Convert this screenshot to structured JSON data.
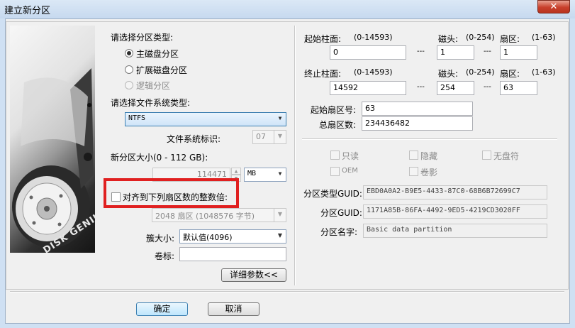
{
  "window": {
    "title": "建立新分区",
    "close_glyph": "✕"
  },
  "image_text": "DISK GENIUS",
  "partition_type": {
    "label": "请选择分区类型:",
    "options": [
      {
        "label": "主磁盘分区",
        "selected": true,
        "enabled": true
      },
      {
        "label": "扩展磁盘分区",
        "selected": false,
        "enabled": true
      },
      {
        "label": "逻辑分区",
        "selected": false,
        "enabled": false
      }
    ]
  },
  "filesystem": {
    "label": "请选择文件系统类型:",
    "value": "NTFS"
  },
  "fs_id": {
    "label": "文件系统标识:",
    "value": "07"
  },
  "size": {
    "label": "新分区大小(0 - 112 GB):",
    "value": "114471",
    "unit": "MB"
  },
  "align": {
    "label": "对齐到下列扇区数的整数倍:",
    "checked": false,
    "value": "2048 扇区 (1048576 字节)"
  },
  "cluster": {
    "label": "簇大小:",
    "value": "默认值(4096)"
  },
  "volume_label": {
    "label": "卷标:",
    "value": ""
  },
  "advanced_button": "详细参数<<",
  "start": {
    "cylinder_label": "起始柱面:",
    "cylinder_range": "(0-14593)",
    "cylinder": "0",
    "head_label": "磁头:",
    "head_range": "(0-254)",
    "head": "1",
    "sector_label": "扇区:",
    "sector_range": "(1-63)",
    "sector": "1"
  },
  "end": {
    "cylinder_label": "终止柱面:",
    "cylinder_range": "(0-14593)",
    "cylinder": "14592",
    "head_label": "磁头:",
    "head_range": "(0-254)",
    "head": "254",
    "sector_label": "扇区:",
    "sector_range": "(1-63)",
    "sector": "63"
  },
  "dash": "---",
  "start_sector": {
    "label": "起始扇区号:",
    "value": "63"
  },
  "total_sectors": {
    "label": "总扇区数:",
    "value": "234436482"
  },
  "flags": {
    "readonly": "只读",
    "hidden": "隐藏",
    "no_drive_letter": "无盘符",
    "oem": "OEM",
    "shadow": "卷影"
  },
  "guid": {
    "type_label": "分区类型GUID:",
    "type_value": "EBD0A0A2-B9E5-4433-87C0-68B6B72699C7",
    "part_label": "分区GUID:",
    "part_value": "1171A85B-86FA-4492-9ED5-4219CD3020FF",
    "name_label": "分区名字:",
    "name_value": "Basic data partition"
  },
  "ok_button": "确定",
  "cancel_button": "取消",
  "colors": {
    "highlight_box": "#e02020",
    "titlebar": "#c6d9ef",
    "dialog_bg": "#f0f0f0"
  }
}
